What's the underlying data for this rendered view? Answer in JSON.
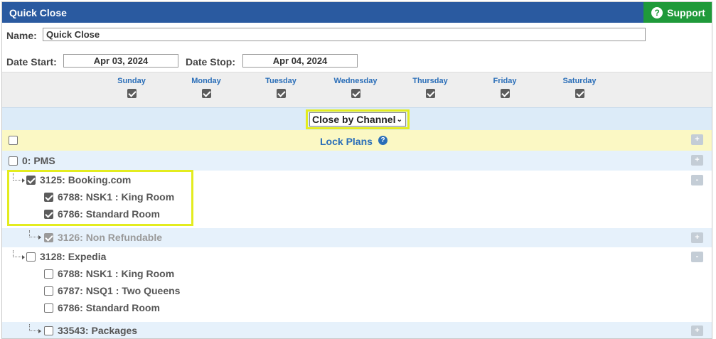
{
  "window": {
    "title": "Quick Close",
    "support_label": "Support",
    "support_icon": "question-circle-icon"
  },
  "form": {
    "name_label": "Name:",
    "name_value": "Quick Close",
    "date_start_label": "Date Start:",
    "date_start_value": "Apr 03, 2024",
    "date_stop_label": "Date Stop:",
    "date_stop_value": "Apr 04, 2024"
  },
  "days": [
    {
      "label": "Sunday",
      "checked": true
    },
    {
      "label": "Monday",
      "checked": true
    },
    {
      "label": "Tuesday",
      "checked": true
    },
    {
      "label": "Wednesday",
      "checked": true
    },
    {
      "label": "Thursday",
      "checked": true
    },
    {
      "label": "Friday",
      "checked": true
    },
    {
      "label": "Saturday",
      "checked": true
    }
  ],
  "channel_select": {
    "value": "Close by Channel"
  },
  "lock": {
    "title": "Lock Plans",
    "checked": false
  },
  "tree": [
    {
      "label": "0: PMS",
      "checked": false
    },
    {
      "label": "3125: Booking.com",
      "checked": true
    },
    {
      "label": "6788: NSK1 : King Room",
      "checked": true
    },
    {
      "label": "6786: Standard Room",
      "checked": true
    },
    {
      "label": "3126: Non Refundable",
      "checked": true,
      "disabled": true
    },
    {
      "label": "3128: Expedia",
      "checked": false
    },
    {
      "label": "6788: NSK1 : King Room",
      "checked": false
    },
    {
      "label": "6787: NSQ1 : Two Queens",
      "checked": false
    },
    {
      "label": "6786: Standard Room",
      "checked": false
    },
    {
      "label": "33543: Packages",
      "checked": false
    }
  ],
  "buttons": {
    "plus": "+",
    "minus": "-"
  },
  "colors": {
    "header": "#2a5aa0",
    "support": "#1f9a3a",
    "highlight": "#e3ec1f",
    "link": "#2a6eb8"
  }
}
